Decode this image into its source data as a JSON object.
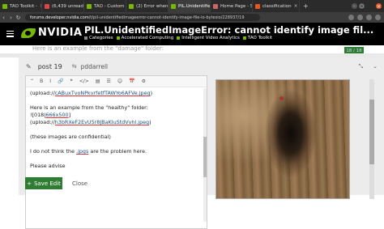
{
  "tabs": [
    {
      "label": "TAO Toolkit -",
      "color": "#76b900"
    },
    {
      "label": "(6,439 unread",
      "color": "#d44"
    },
    {
      "label": "TAO - Custom",
      "color": "#76b900"
    },
    {
      "label": "(2) Error when",
      "color": "#76b900"
    },
    {
      "label": "PIL.UnidentifiedI",
      "color": "#76b900",
      "active": true
    },
    {
      "label": "Home Page - S",
      "color": "#c66"
    },
    {
      "label": "classification",
      "color": "#e95420"
    }
  ],
  "url": {
    "host": "forums.developer.nvidia.com",
    "path": "/t/pil-unidentifiedimageerror-cannot-identify-image-file-io-bytesio/228937/19"
  },
  "header": {
    "logo": "NVIDIA",
    "topic_title": "PIL.UnidentifiedImageError: cannot identify image fil...",
    "categories": [
      {
        "label": "Categories",
        "color": "#888"
      },
      {
        "label": "Accelerated Computing",
        "color": "#76b900"
      },
      {
        "label": "Intelligent Video Analytics",
        "color": "#76b900"
      },
      {
        "label": "TAO Toolkit",
        "color": "#76b900"
      }
    ]
  },
  "background": {
    "text": "Here is an example from the \"damage\" folder:",
    "counter": "18 / 18"
  },
  "composer": {
    "post_label": "post 19",
    "username": "pddarrell",
    "toolbar": [
      "“",
      "B",
      "I",
      "🔗",
      "❝",
      "</>",
      "▤",
      "☰",
      "☺",
      "📅",
      "⚙"
    ],
    "lines": [
      {
        "text": "(upload://",
        "link": "cABuxTvoNPkvrfetfTAWYo6AFVe.jpeg",
        "tail": ")"
      },
      {
        "text": ""
      },
      {
        "text": "Here is an example from the \"healthy\" folder:"
      },
      {
        "text": "![018|",
        "link": "666x500",
        "tail": "]"
      },
      {
        "text": "(upload://",
        "link": "h3bRXeF2EvU5r8JBaKIuStdVvhl.jpeg",
        "tail": ")"
      },
      {
        "text": ""
      },
      {
        "text": "(these images are confidential)"
      },
      {
        "text": ""
      },
      {
        "text": "I do not think the ",
        "link": ".jpgs",
        "tail": " are the problem here."
      },
      {
        "text": ""
      },
      {
        "text": "Please advise"
      }
    ],
    "save_label": "Save Edit",
    "close_label": "Close"
  }
}
